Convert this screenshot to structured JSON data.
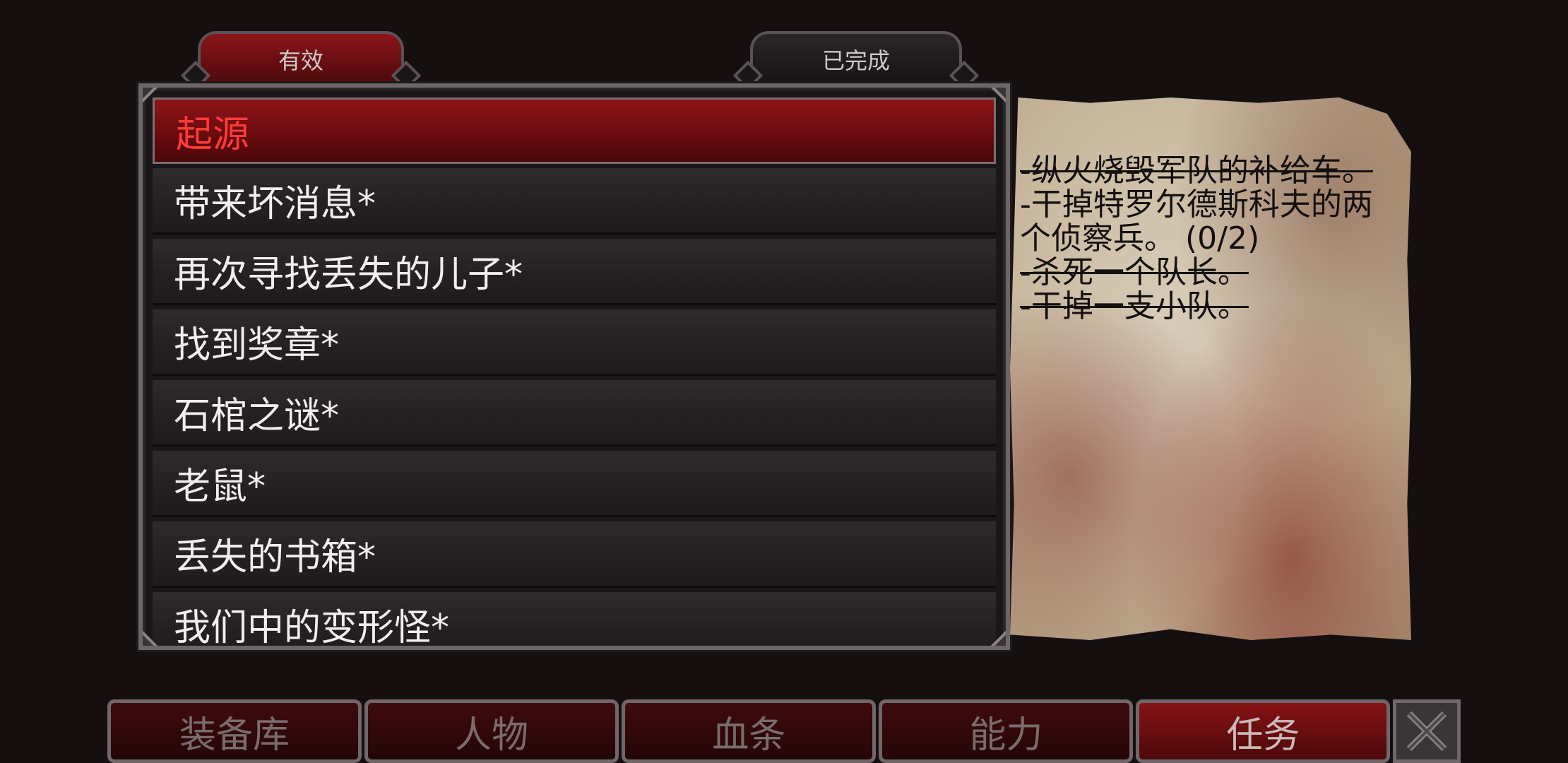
{
  "tabs": [
    {
      "label": "有效",
      "active": true
    },
    {
      "label": "已完成",
      "active": false
    }
  ],
  "quests": [
    {
      "label": "起源",
      "selected": true
    },
    {
      "label": "带来坏消息*",
      "selected": false
    },
    {
      "label": "再次寻找丢失的儿子*",
      "selected": false
    },
    {
      "label": "找到奖章*",
      "selected": false
    },
    {
      "label": "石棺之谜*",
      "selected": false
    },
    {
      "label": "老鼠*",
      "selected": false
    },
    {
      "label": "丢失的书箱*",
      "selected": false
    },
    {
      "label": "我们中的变形怪*",
      "selected": false
    }
  ],
  "objectives": [
    {
      "text": "-纵火烧毁军队的补给车。",
      "done": true
    },
    {
      "text": "-干掉特罗尔德斯科夫的两个侦察兵。 (0/2)",
      "done": false
    },
    {
      "text": "-杀死一个队长。",
      "done": true
    },
    {
      "text": "-干掉一支小队。",
      "done": true
    }
  ],
  "menu": [
    {
      "label": "装备库",
      "active": false
    },
    {
      "label": "人物",
      "active": false
    },
    {
      "label": "血条",
      "active": false
    },
    {
      "label": "能力",
      "active": false
    },
    {
      "label": "任务",
      "active": true
    }
  ],
  "close_icon": "close-x-icon",
  "colors": {
    "accent_red": "#8d1418",
    "selected_text": "#ff3b3b",
    "background": "#150f10"
  }
}
